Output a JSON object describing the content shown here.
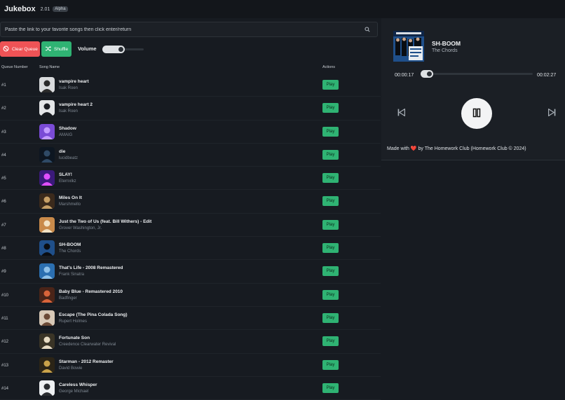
{
  "app": {
    "title": "Jukebox",
    "version": "2.01",
    "badge": "Alpha"
  },
  "search": {
    "placeholder": "Paste the link to your favorite songs then click enter/return",
    "icon": "search-icon"
  },
  "controls": {
    "clear_label": "Clear Queue",
    "shuffle_label": "Shuffle",
    "volume_label": "Volume",
    "volume_level": 0.55
  },
  "table": {
    "headers": [
      "Queue Number",
      "Song Name",
      "Actions"
    ],
    "play_label": "Play"
  },
  "queue": [
    {
      "number": "#1",
      "title": "vampire heart",
      "artist": "Isak Roen"
    },
    {
      "number": "#2",
      "title": "vampire heart 2",
      "artist": "Isak Roen"
    },
    {
      "number": "#3",
      "title": "Shadow",
      "artist": "AMAIG"
    },
    {
      "number": "#4",
      "title": "die",
      "artist": "lucidbeatz"
    },
    {
      "number": "#5",
      "title": "SLAY!",
      "artist": "Eternxlkz"
    },
    {
      "number": "#6",
      "title": "Miles On It",
      "artist": "Marshmello"
    },
    {
      "number": "#7",
      "title": "Just the Two of Us (feat. Bill Withers) - Edit",
      "artist": "Grover Washington, Jr."
    },
    {
      "number": "#8",
      "title": "SH-BOOM",
      "artist": "The Chords"
    },
    {
      "number": "#9",
      "title": "That's Life - 2008 Remastered",
      "artist": "Frank Sinatra"
    },
    {
      "number": "#10",
      "title": "Baby Blue - Remastered 2010",
      "artist": "Badfinger"
    },
    {
      "number": "#11",
      "title": "Escape (The Pina Colada Song)",
      "artist": "Rupert Holmes"
    },
    {
      "number": "#12",
      "title": "Fortunate Son",
      "artist": "Creedence Clearwater Revival"
    },
    {
      "number": "#13",
      "title": "Starman - 2012 Remaster",
      "artist": "David Bowie"
    },
    {
      "number": "#14",
      "title": "Careless Whisper",
      "artist": "George Michael"
    }
  ],
  "now_playing": {
    "title": "SH-BOOM",
    "artist": "The Chords",
    "elapsed": "00:00:17",
    "total": "00:02:27",
    "progress": 0.115
  },
  "footer": {
    "prefix": "Made with",
    "heart": "❤️",
    "suffix": "by The Homework Club (Homework Club © 2024)"
  },
  "colors": {
    "background": "#171b21",
    "danger": "#ef5356",
    "success": "#2fb373"
  }
}
